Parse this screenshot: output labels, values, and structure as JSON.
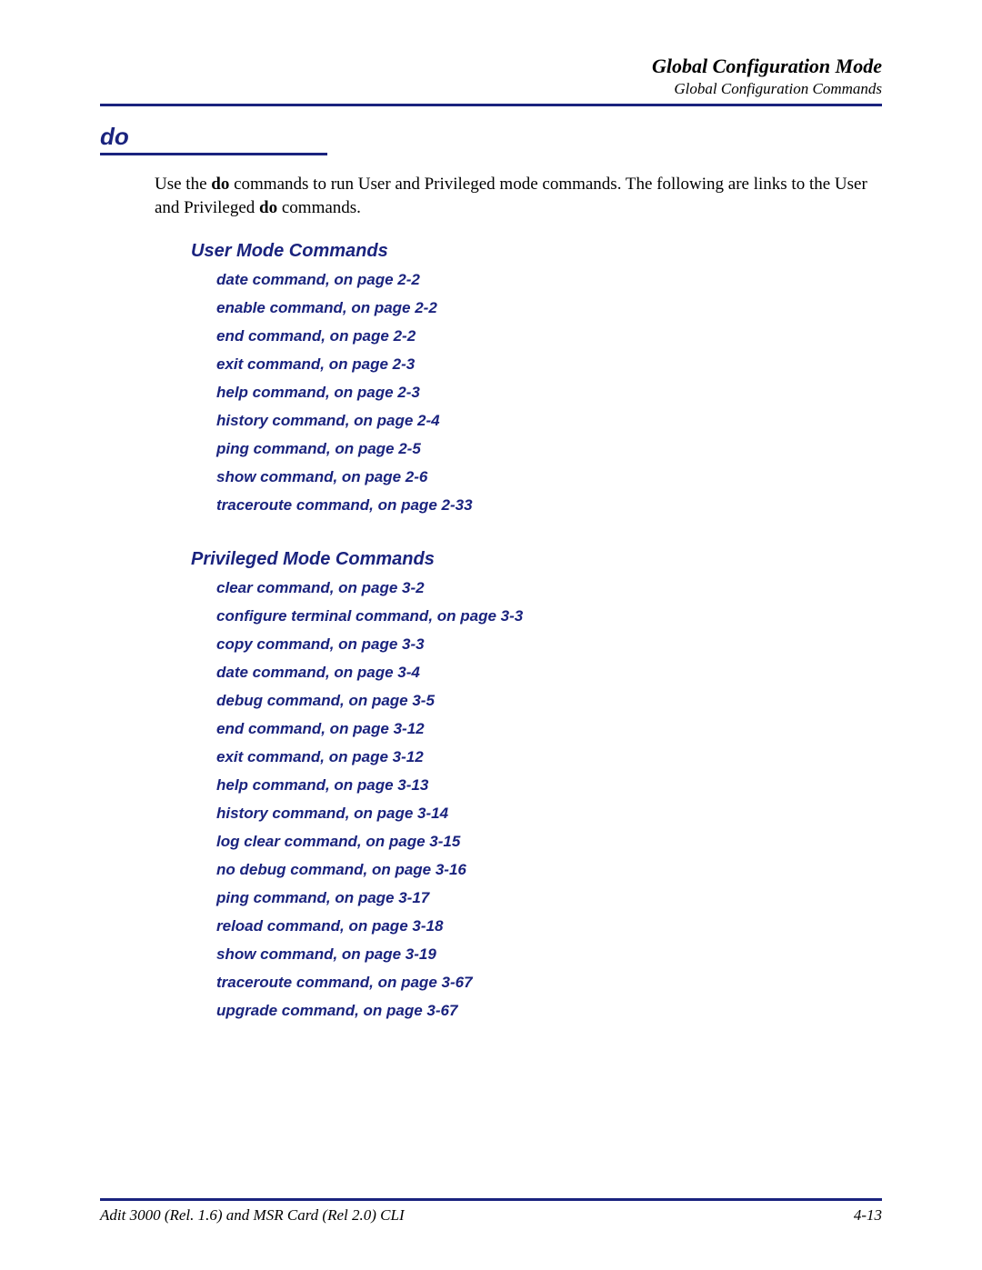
{
  "header": {
    "title": "Global Configuration Mode",
    "subtitle": "Global Configuration Commands"
  },
  "section": {
    "title": "do"
  },
  "intro": {
    "prefix": "Use the ",
    "bold1": "do",
    "middle1": " commands to run User and Privileged mode commands. The following are links to the User and Privileged ",
    "bold2": "do",
    "suffix": " commands."
  },
  "userMode": {
    "heading": "User Mode Commands",
    "links": [
      "date command, on page 2-2",
      "enable command, on page 2-2",
      "end command, on page 2-2",
      "exit command, on page 2-3",
      "help command, on page 2-3",
      "history command, on page 2-4",
      "ping command, on page 2-5",
      "show command, on page 2-6",
      "traceroute command, on page 2-33"
    ]
  },
  "privMode": {
    "heading": "Privileged Mode Commands",
    "links": [
      "clear command, on page 3-2",
      "configure terminal command, on page 3-3",
      "copy command, on page 3-3",
      "date command, on page 3-4",
      "debug command, on page 3-5",
      "end command, on page 3-12",
      "exit command, on page 3-12",
      "help command, on page 3-13",
      "history command, on page 3-14",
      "log clear command, on page 3-15",
      "no debug command, on page 3-16",
      "ping command, on page 3-17",
      "reload command, on page 3-18",
      "show command, on page 3-19",
      "traceroute command, on page 3-67",
      "upgrade command, on page 3-67"
    ]
  },
  "footer": {
    "left": "Adit 3000 (Rel. 1.6) and MSR Card (Rel 2.0) CLI",
    "right": "4-13"
  }
}
